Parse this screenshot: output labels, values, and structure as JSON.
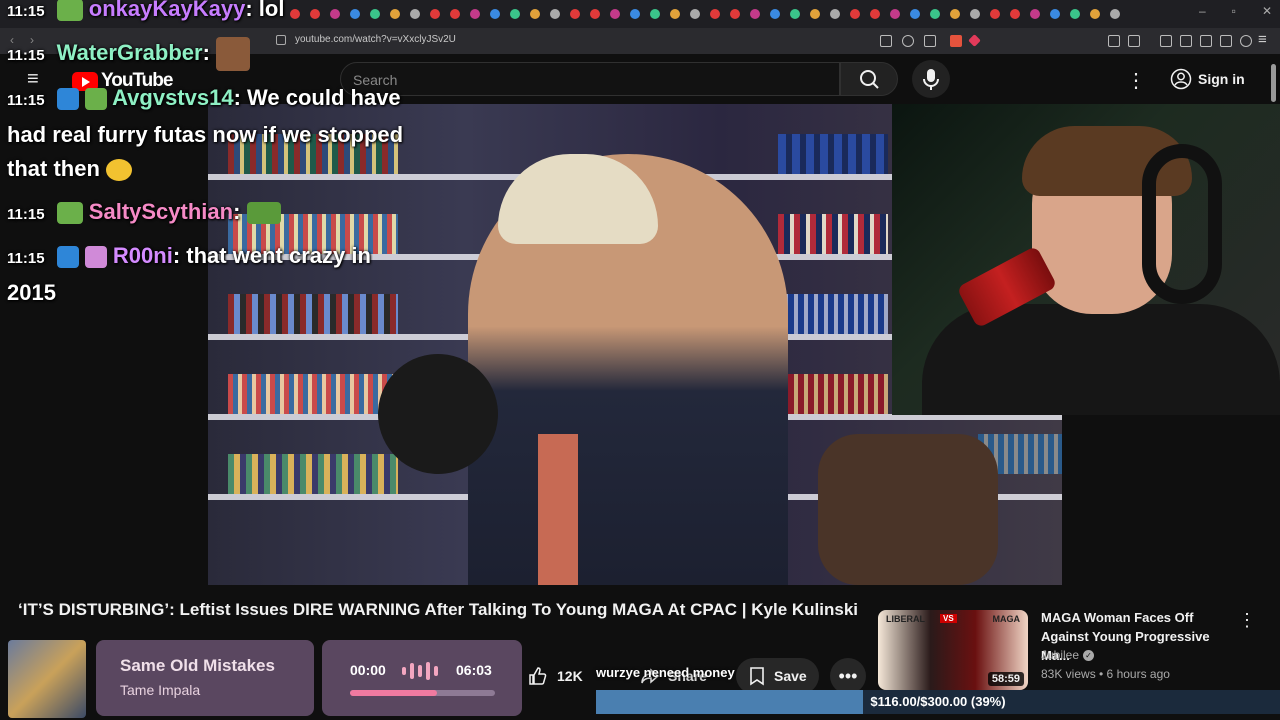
{
  "browser": {
    "url": "youtube.com/watch?v=vXxclyJSv2U"
  },
  "youtube": {
    "logo_text": "YouTube",
    "search_placeholder": "Search",
    "signin_label": "Sign in"
  },
  "chat": {
    "messages": [
      {
        "time": "11:15",
        "user": "onkayKayKayy",
        "user_color": "#c77dff",
        "text": "lol"
      },
      {
        "time": "11:15",
        "user": "WaterGrabber",
        "user_color": "#8ef0c4",
        "text": ""
      },
      {
        "time": "11:15",
        "user": "Avgvstvs14",
        "user_color": "#8ef0c4",
        "text": "We could have had real furry futas now if we stopped that then"
      },
      {
        "time": "11:15",
        "user": "SaltyScythian",
        "user_color": "#f58ac6",
        "text": ""
      },
      {
        "time": "11:15",
        "user": "R00ni",
        "user_color": "#d48bff",
        "text": "that went crazy in 2015"
      }
    ]
  },
  "video": {
    "title": "‘IT’S DISTURBING’: Leftist Issues DIRE WARNING After Talking To Young MAGA At CPAC | Kyle Kulinski",
    "like_count": "12K",
    "share_label": "Share",
    "save_label": "Save",
    "tts_text": "wurzye neneed money"
  },
  "now_playing": {
    "song": "Same Old Mistakes",
    "artist": "Tame Impala",
    "current_time": "00:00",
    "duration": "06:03",
    "progress": 0.6
  },
  "recommended": {
    "title": "MAGA Woman Faces Off Against Young Progressive Ma...",
    "channel": "Jubilee",
    "meta": "83K views • 6 hours ago",
    "duration": "58:59",
    "thumb_left_label": "LIBERAL",
    "thumb_vs": "VS",
    "thumb_right_label": "MAGA"
  },
  "goal": {
    "text": "$116.00/$300.00 (39%)",
    "progress": 0.39
  }
}
